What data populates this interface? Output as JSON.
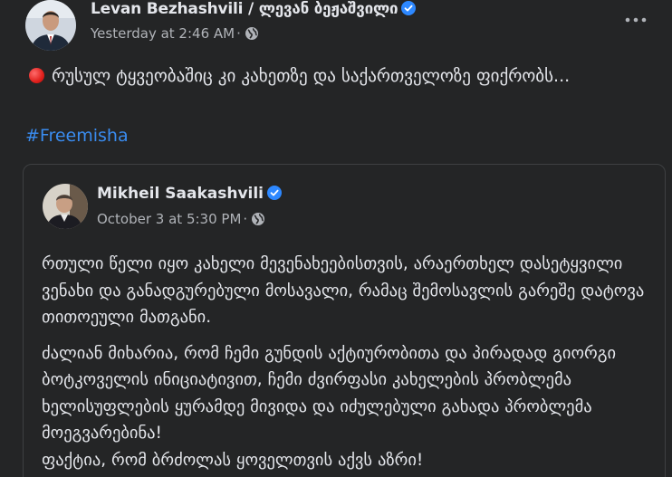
{
  "post": {
    "author": "Levan Bezhashvili / ლევან ბეჟაშვილი",
    "timestamp": "Yesterday at 2:46 AM",
    "separator": "·",
    "text": "რუსულ ტყვეობაშიც კი კახეთზე და საქართველოზე ფიქრობს...",
    "hashtag": "#Freemisha"
  },
  "shared": {
    "author": "Mikheil Saakashvili",
    "timestamp": "October 3 at 5:30 PM",
    "separator": "·",
    "paragraphs": [
      "რთული წელი იყო კახელი მევენახეებისთვის, არაერთხელ დასეტყვილი ვენახი და განადგურებული მოსავალი, რამაც შემოსავლის გარეშე დატოვა თითოეული მათგანი.",
      "ძალიან მიხარია, რომ ჩემი გუნდის აქტიურობითა და პირადად გიორგი ბოტკოველის ინიციატივით, ჩემი ძვირფასი კახელების პრობლემა ხელისუფლების ყურამდე მივიდა და იძულებული გახადა პრობლემა მოეგვარებინა!",
      "ფაქტია, რომ ბრძოლას ყოველთვის აქვს აზრი!"
    ]
  },
  "colors": {
    "background": "#242526",
    "primary_text": "#e4e6eb",
    "secondary_text": "#b0b3b8",
    "link": "#3a8cf0",
    "verified_badge": "#2d88ff",
    "card_border": "#3e4042"
  },
  "icons": {
    "verified": "verified-badge-icon",
    "audience": "globe-icon",
    "more": "more-options-icon",
    "red_circle": "red-circle-emoji"
  }
}
